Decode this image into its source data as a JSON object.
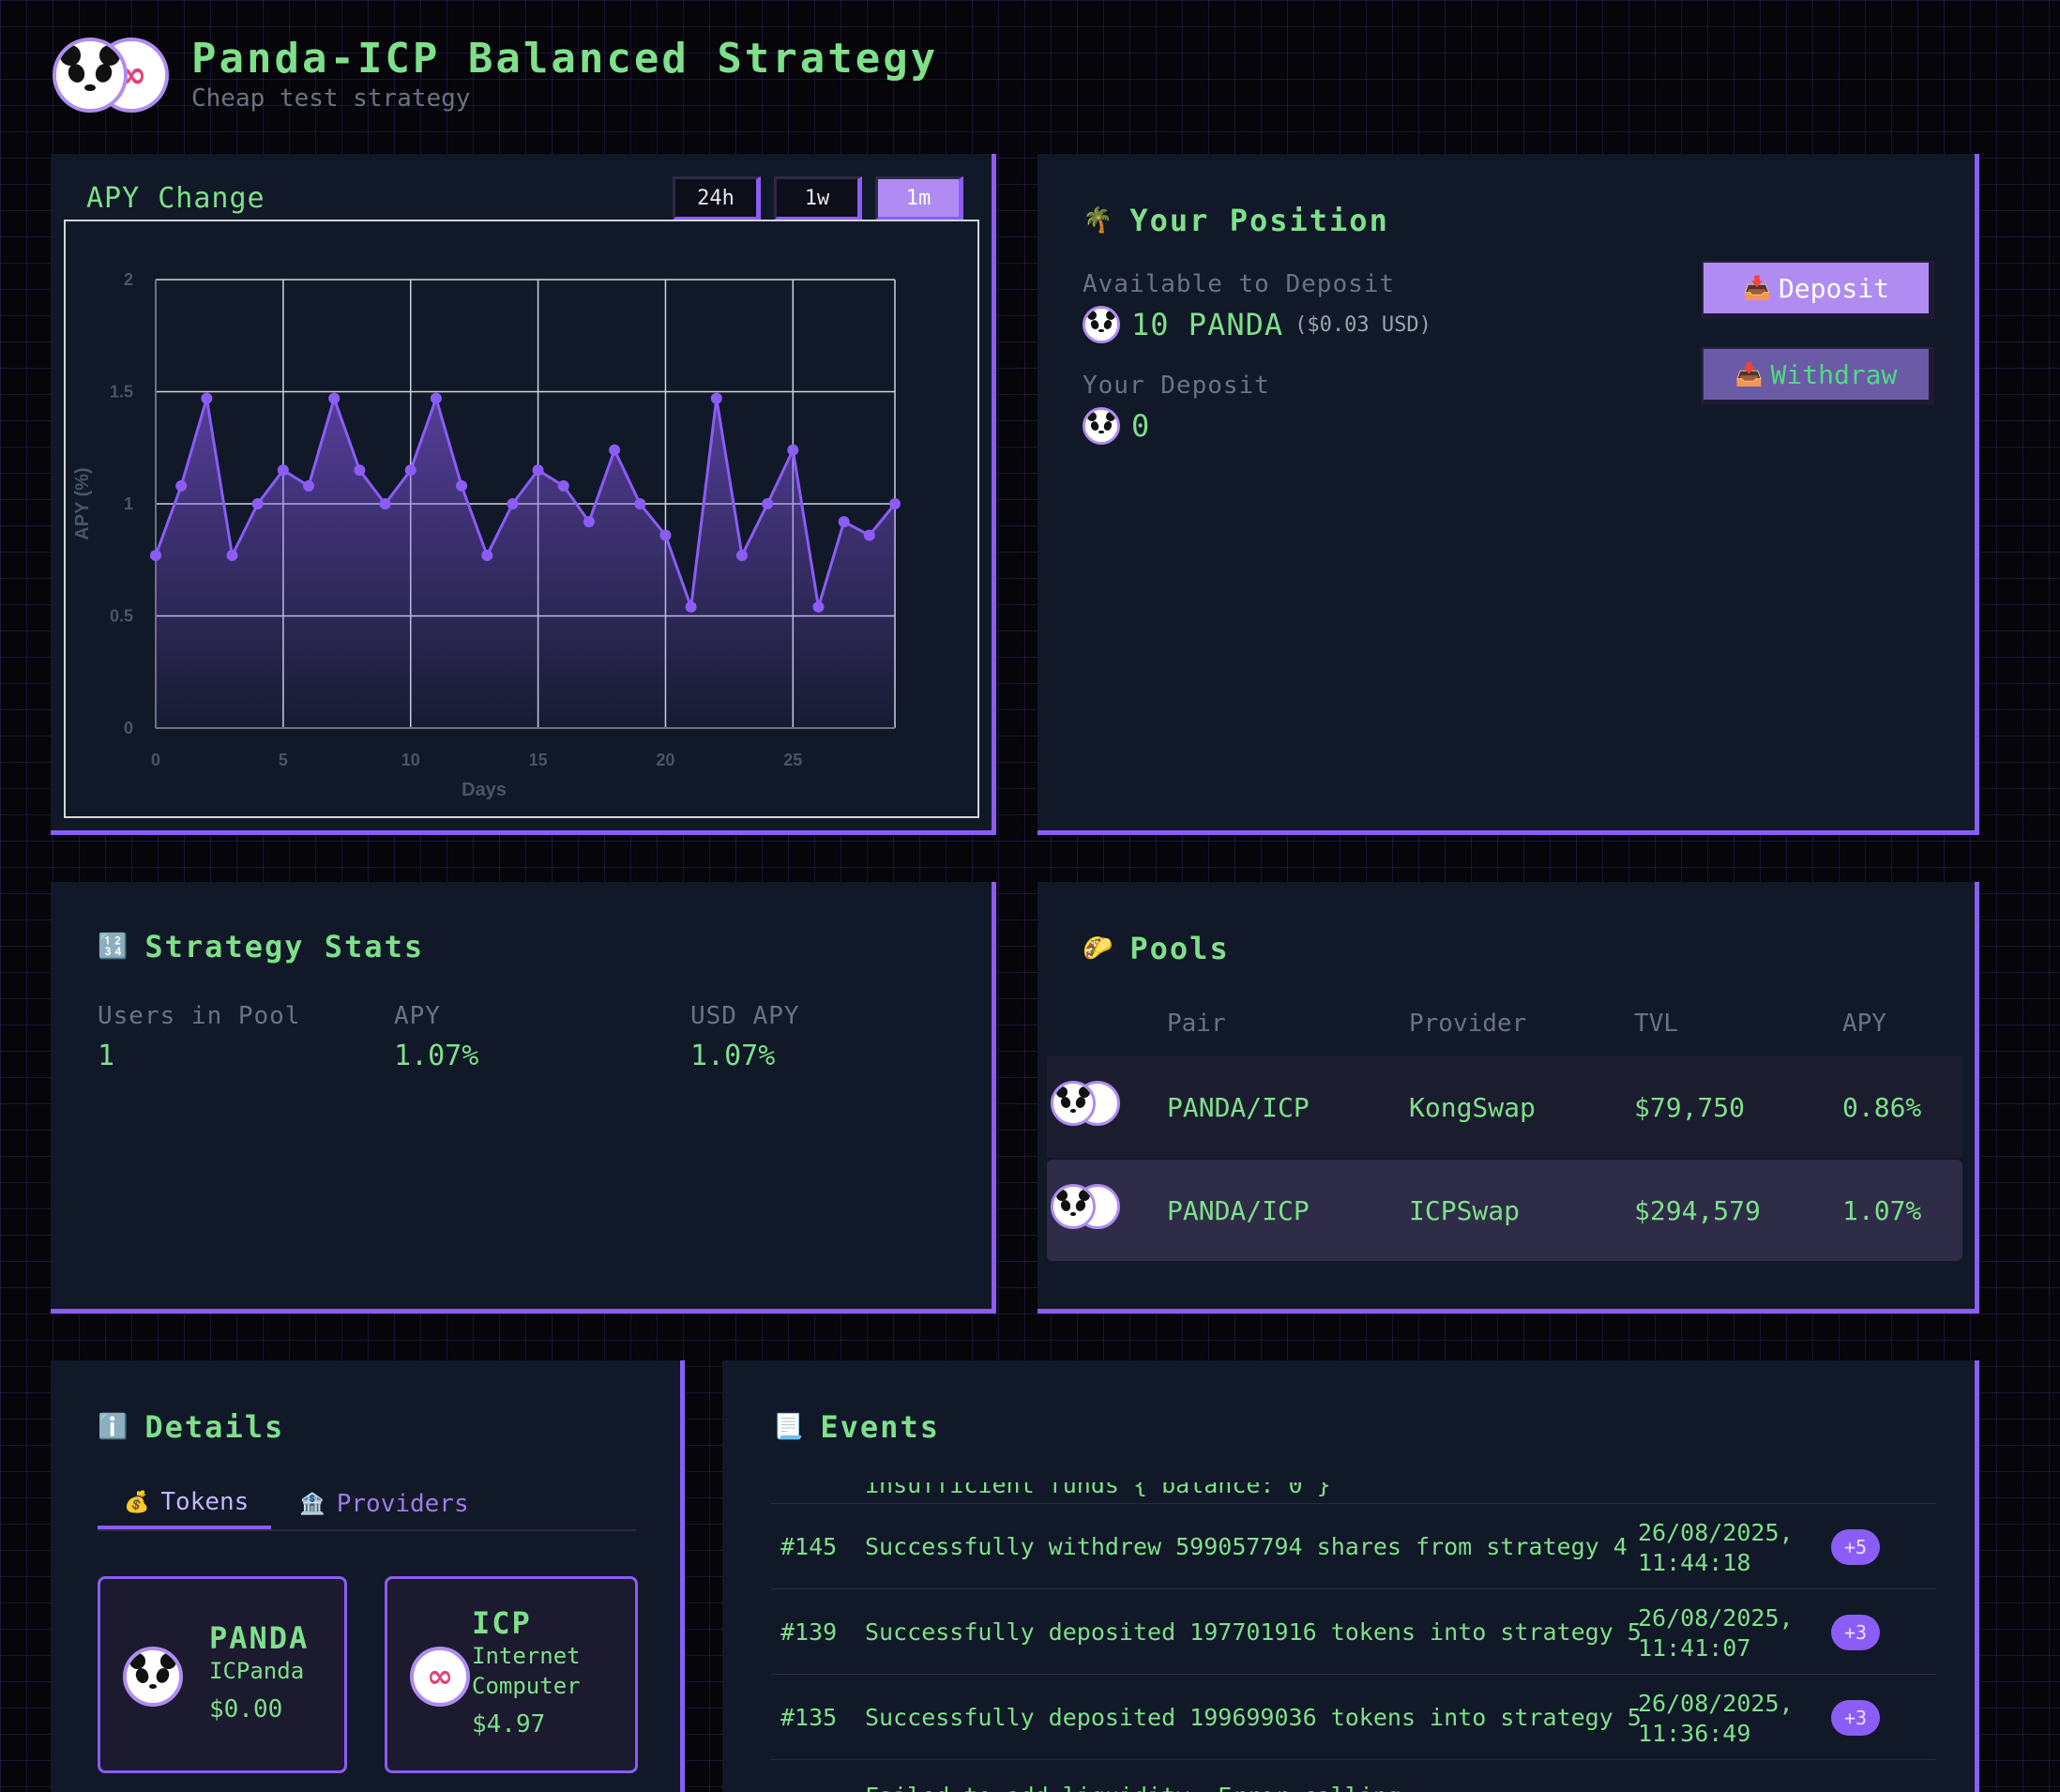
{
  "header": {
    "title": "Panda-ICP Balanced Strategy",
    "subtitle": "Cheap test strategy"
  },
  "apy_panel": {
    "title": "APY Change",
    "ranges": [
      "24h",
      "1w",
      "1m"
    ],
    "active_range": "1m"
  },
  "chart_data": {
    "type": "area",
    "xlabel": "Days",
    "ylabel": "APY (%)",
    "xlim": [
      0,
      29
    ],
    "ylim": [
      0,
      2
    ],
    "x_ticks": [
      "0",
      "5",
      "10",
      "15",
      "20",
      "25"
    ],
    "y_ticks": [
      "0",
      "0.5",
      "1",
      "1.5",
      "2"
    ],
    "grid": true,
    "color": "#8b5cf6",
    "series": [
      {
        "x": [
          0,
          1,
          2,
          3,
          4,
          5,
          6,
          7,
          8,
          9,
          10,
          11,
          12,
          13,
          14,
          15,
          16,
          17,
          18,
          19,
          20,
          21,
          22,
          23,
          24,
          25,
          26,
          27,
          28,
          29
        ],
        "values": [
          0.77,
          1.08,
          1.47,
          0.77,
          1.0,
          1.15,
          1.08,
          1.47,
          1.15,
          1.0,
          1.15,
          1.47,
          1.08,
          0.77,
          1.0,
          1.15,
          1.08,
          0.92,
          1.24,
          1.0,
          0.86,
          0.54,
          1.47,
          0.77,
          1.0,
          1.24,
          0.54,
          0.92,
          0.86,
          1.0
        ]
      }
    ]
  },
  "position": {
    "title": "Your Position",
    "title_emoji": "🌴",
    "available_label": "Available to Deposit",
    "available_value": "10 PANDA",
    "available_usd": "($0.03 USD)",
    "deposit_label": "Your Deposit",
    "deposit_value": "0",
    "deposit_button": "Deposit",
    "withdraw_button": "Withdraw",
    "button_emoji": "📥"
  },
  "stats": {
    "title": "Strategy Stats",
    "title_emoji": "🔢",
    "items": [
      {
        "label": "Users in Pool",
        "value": "1"
      },
      {
        "label": "APY",
        "value": "1.07%"
      },
      {
        "label": "USD APY",
        "value": "1.07%"
      }
    ]
  },
  "pools": {
    "title": "Pools",
    "title_emoji": "🌮",
    "columns": [
      "Pair",
      "Provider",
      "TVL",
      "APY"
    ],
    "rows": [
      {
        "pair": "PANDA/ICP",
        "provider": "KongSwap",
        "tvl": "$79,750",
        "apy": "0.86%"
      },
      {
        "pair": "PANDA/ICP",
        "provider": "ICPSwap",
        "tvl": "$294,579",
        "apy": "1.07%"
      }
    ]
  },
  "details": {
    "title": "Details",
    "title_emoji": "ℹ️",
    "tabs": [
      {
        "label": "Tokens",
        "emoji": "💰"
      },
      {
        "label": "Providers",
        "emoji": "🏦"
      }
    ],
    "tokens": [
      {
        "symbol": "PANDA",
        "name": "ICPanda",
        "price": "$0.00"
      },
      {
        "symbol": "ICP",
        "name": "Internet Computer",
        "price": "$4.97"
      }
    ]
  },
  "events": {
    "title": "Events",
    "title_emoji": "📃",
    "top_cut_text": "insufficient funds { balance: 0 }",
    "rows": [
      {
        "id": "#145",
        "message": "Successfully withdrew 599057794 shares from strategy 4",
        "date": "26/08/2025,",
        "time": "11:44:18",
        "badge": "+5"
      },
      {
        "id": "#139",
        "message": "Successfully deposited 197701916 tokens into strategy 5",
        "date": "26/08/2025,",
        "time": "11:41:07",
        "badge": "+3"
      },
      {
        "id": "#135",
        "message": "Successfully deposited 199699036 tokens into strategy 5",
        "date": "26/08/2025,",
        "time": "11:36:49",
        "badge": "+3"
      }
    ],
    "bottom_cut_text": "Failed to add liquidity: Error calling"
  }
}
